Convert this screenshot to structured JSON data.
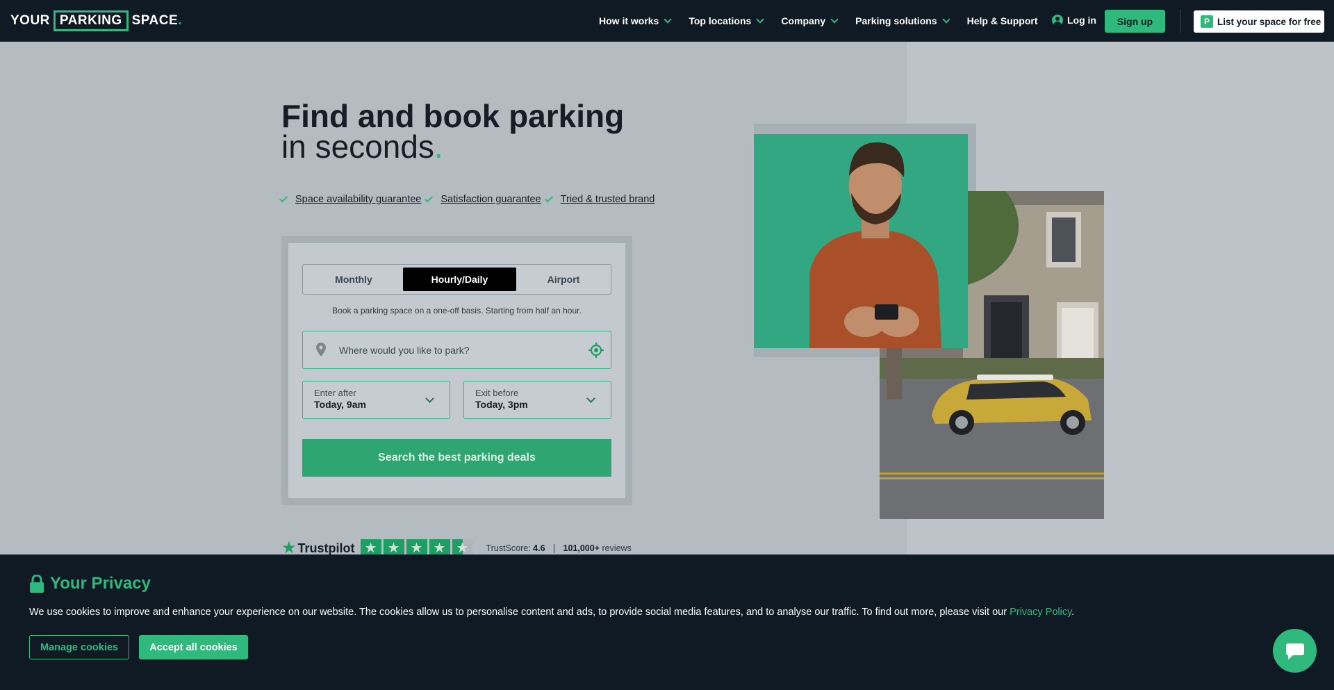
{
  "header": {
    "logo": {
      "part1": "YOUR",
      "part2": "PARKING",
      "part3": "SPACE",
      "dot": "."
    },
    "nav": [
      "How it works",
      "Top locations",
      "Company",
      "Parking solutions"
    ],
    "help": "Help & Support",
    "login": "Log in",
    "signup": "Sign up",
    "list_space": "List your space for free",
    "list_icon_letter": "P"
  },
  "hero": {
    "title_line1": "Find and book parking",
    "title_line2": "in seconds",
    "title_dot": ".",
    "guarantees": [
      "Space availability guarantee",
      "Satisfaction guarantee",
      "Tried & trusted brand"
    ]
  },
  "search": {
    "tabs": [
      "Monthly",
      "Hourly/Daily",
      "Airport"
    ],
    "active_tab": "Hourly/Daily",
    "description": "Book a parking space on a one-off basis. Starting from half an hour.",
    "location_placeholder": "Where would you like to park?",
    "enter_label": "Enter after",
    "enter_value": "Today, 9am",
    "exit_label": "Exit before",
    "exit_value": "Today, 3pm",
    "button": "Search the best parking deals"
  },
  "trustpilot": {
    "brand": "Trustpilot",
    "star_count": 4.5,
    "score_label": "TrustScore:",
    "score": "4.6",
    "reviews": "101,000+",
    "reviews_label": "reviews"
  },
  "cookie": {
    "title": "Your Privacy",
    "text": "We use cookies to improve and enhance your experience on our website. The cookies allow us to personalise content and ads, to provide social media features, and to analyse our traffic. To find out more, please visit our ",
    "policy_link": "Privacy Policy",
    "text_end": ".",
    "manage": "Manage cookies",
    "accept": "Accept all cookies"
  },
  "colors": {
    "brand_green": "#2fb97c",
    "header_bg": "#0f1a24"
  }
}
